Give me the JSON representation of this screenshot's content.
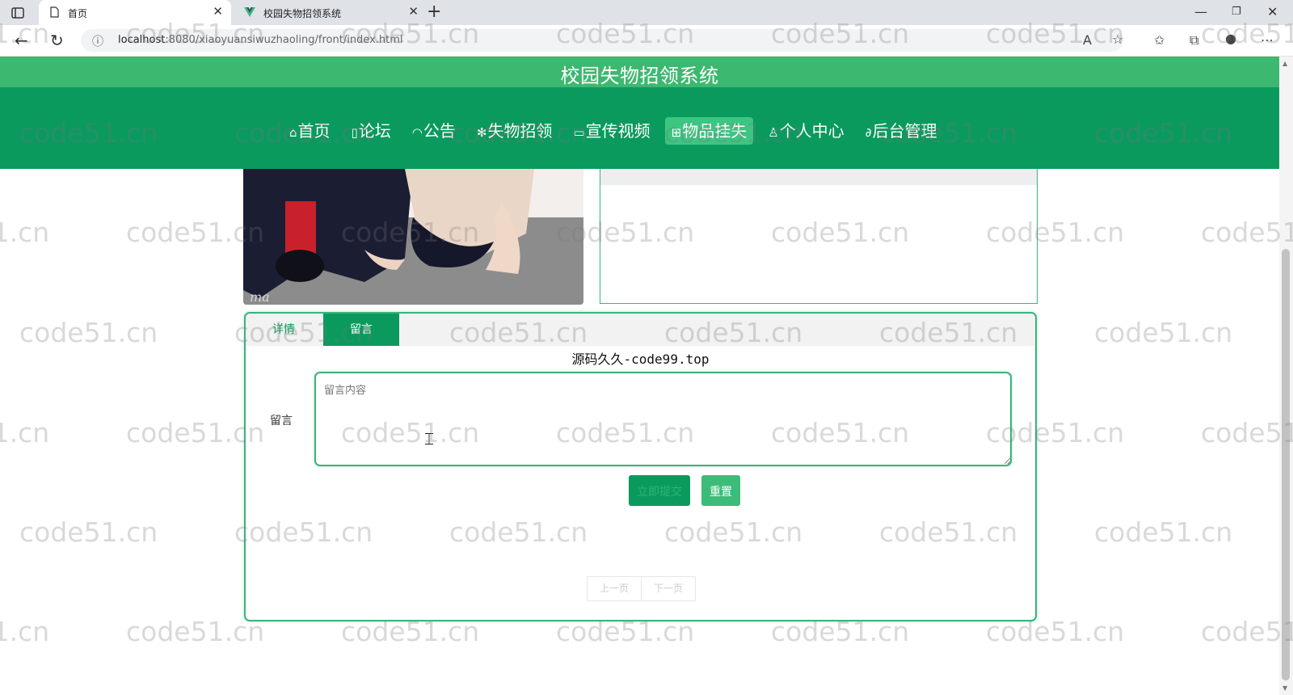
{
  "browser": {
    "tabs": [
      {
        "label": "首页",
        "active": true
      },
      {
        "label": "校园失物招领系统",
        "active": false
      }
    ],
    "url_host": "localhost",
    "url_rest": ":8080/xiaoyuansiwuzhaoling/front/index.html"
  },
  "site": {
    "title": "校园失物招领系统",
    "nav": [
      {
        "icon": "⌂",
        "label": "首页",
        "active": false
      },
      {
        "icon": "▯",
        "label": "论坛",
        "active": false
      },
      {
        "icon": "◠",
        "label": "公告",
        "active": false
      },
      {
        "icon": "✻",
        "label": "失物招领",
        "active": false
      },
      {
        "icon": "▭",
        "label": "宣传视频",
        "active": false
      },
      {
        "icon": "⊞",
        "label": "物品挂失",
        "active": true
      },
      {
        "icon": "♙",
        "label": "个人中心",
        "active": false
      },
      {
        "icon": "∂",
        "label": "后台管理",
        "active": false
      }
    ],
    "accent": "#0a9a5e",
    "title_bar_color": "#3db870"
  },
  "detail": {
    "tabs": {
      "detail": "详情",
      "comment": "留言"
    },
    "notice": "源码久久-code99.top",
    "comment_label": "留言",
    "comment_placeholder": "留言内容",
    "submit_label": "立即提交",
    "reset_label": "重置",
    "pager": {
      "prev": "上一页",
      "next": "下一页"
    }
  },
  "watermark": "code51.cn"
}
